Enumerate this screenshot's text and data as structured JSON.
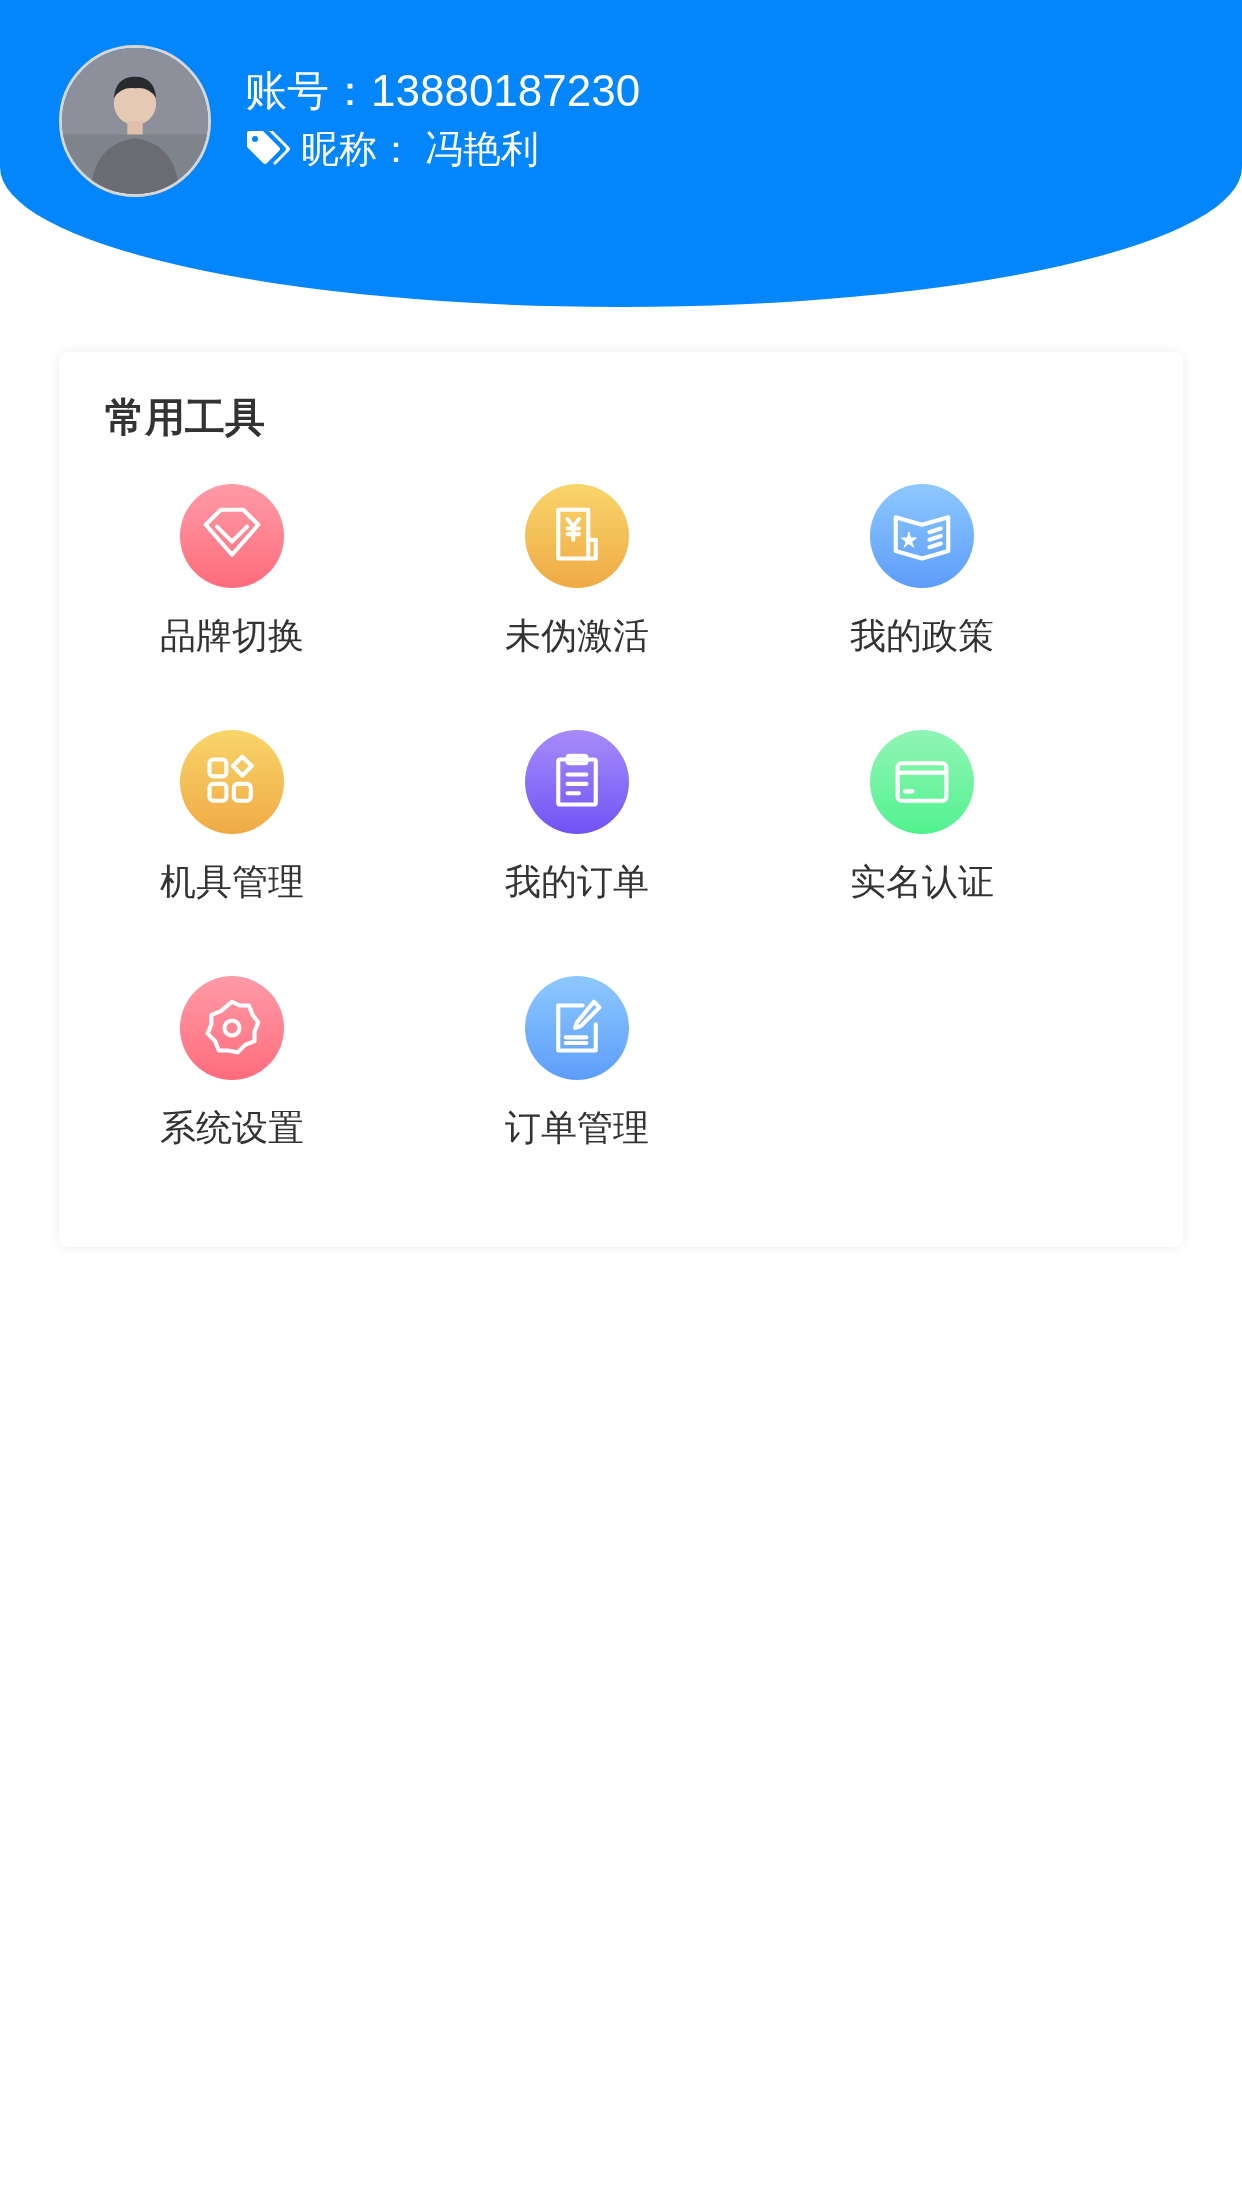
{
  "profile": {
    "account_label": "账号：",
    "account": "13880187230",
    "nickname_label": "昵称：",
    "nickname": "冯艳利"
  },
  "tools": {
    "title": "常用工具",
    "items": [
      {
        "label": "品牌切换"
      },
      {
        "label": "未伪激活"
      },
      {
        "label": "我的政策"
      },
      {
        "label": "机具管理"
      },
      {
        "label": "我的订单"
      },
      {
        "label": "实名认证"
      },
      {
        "label": "系统设置"
      },
      {
        "label": "订单管理"
      }
    ]
  }
}
